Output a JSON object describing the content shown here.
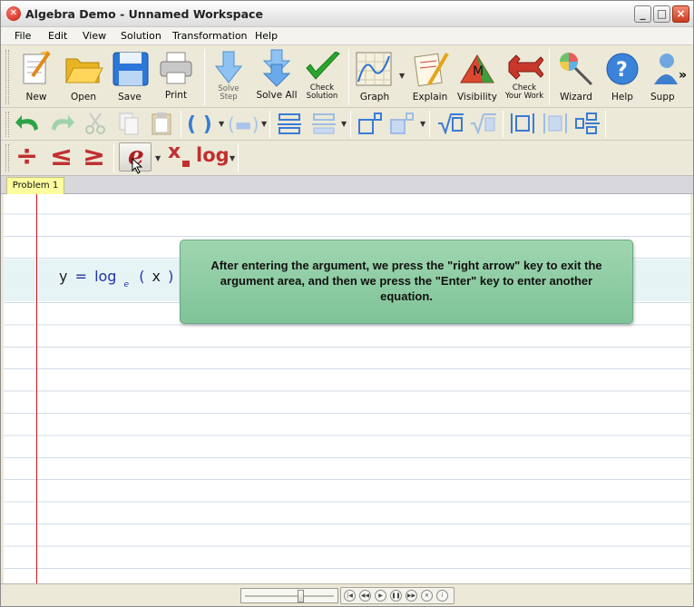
{
  "window": {
    "title": "Algebra Demo - Unnamed Workspace",
    "controls": {
      "minimize": "_",
      "maximize": "□",
      "close": "×"
    }
  },
  "menu": [
    "File",
    "Edit",
    "View",
    "Solution",
    "Transformation",
    "Help"
  ],
  "toolbar1": {
    "new": "New",
    "open": "Open",
    "save": "Save",
    "print": "Print",
    "solve_step_1": "Solve",
    "solve_step_2": "Step",
    "solve_all": "Solve All",
    "check_solution_1": "Check",
    "check_solution_2": "Solution",
    "graph": "Graph",
    "explain": "Explain",
    "visibility": "Visibility",
    "check_work_1": "Check",
    "check_work_2": "Your Work",
    "wizard": "Wizard",
    "help": "Help",
    "support": "Supp",
    "overflow": "»"
  },
  "toolbar3": {
    "divide": "÷",
    "less_equal": "≤",
    "greater_equal": "≥",
    "e_const": "e",
    "subscript_x": "x",
    "log": "log"
  },
  "tabs": [
    "Problem 1"
  ],
  "equation": {
    "lhs": "y",
    "eq": "=",
    "func": "log",
    "base": "e",
    "lparen": "(",
    "arg": "x",
    "rparen": ")"
  },
  "callout": {
    "text": "After entering the argument, we press the \"right arrow\" key to exit the argument area, and then we press the \"Enter\" key to enter another equation."
  },
  "playback": {
    "slider_fraction": 0.63,
    "buttons": [
      "|◀",
      "◀◀",
      "▶",
      "❚❚",
      "▶▶",
      "✕",
      "i"
    ]
  },
  "colors": {
    "accent_blue": "#3a7bd5",
    "margin_red": "#c9181e",
    "callout_green": "#8fcca4",
    "tab_yellow": "#fdfc9e"
  }
}
